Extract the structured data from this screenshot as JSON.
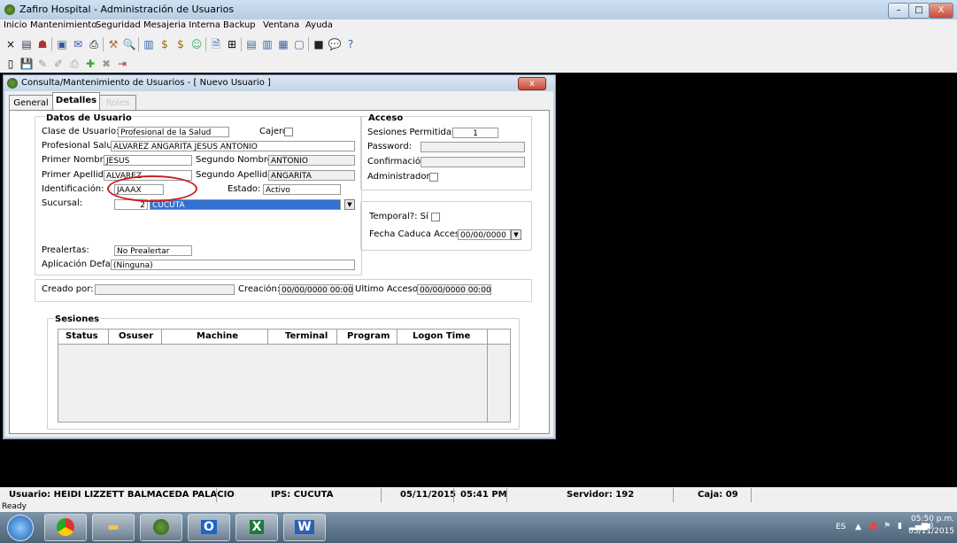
{
  "window": {
    "title": "Zafiro Hospital - Administración de Usuarios",
    "minimize": "–",
    "maximize": "□",
    "close": "X"
  },
  "menu": [
    "Inicio",
    "Mantenimiento",
    "Seguridad",
    "Mesajeria Interna",
    "Backup",
    "Ventana",
    "Ayuda"
  ],
  "dialog": {
    "title": "Consulta/Mantenimiento de Usuarios - [ Nuevo Usuario ]",
    "close": "x",
    "tabs": [
      "General",
      "Detalles",
      "Roles"
    ]
  },
  "datos": {
    "group_title": "Datos de Usuario",
    "clase_label": "Clase de Usuario:",
    "clase_value": "Profesional de la Salud",
    "cajero_label": "Cajero",
    "profesional_label": "Profesional Salud:",
    "profesional_value": "ALVAREZ ANGARITA JESUS ANTONIO",
    "primer_nombre_label": "Primer Nombre:",
    "primer_nombre_value": "JESUS",
    "segundo_nombre_label": "Segundo Nombre:",
    "segundo_nombre_value": "ANTONIO",
    "primer_apellido_label": "Primer Apellido:",
    "primer_apellido_value": "ALVAREZ",
    "segundo_apellido_label": "Segundo Apellido:",
    "segundo_apellido_value": "ANGARITA",
    "identificacion_label": "Identificación:",
    "identificacion_value": "JAAAX",
    "estado_label": "Estado:",
    "estado_value": "Activo",
    "sucursal_label": "Sucursal:",
    "sucursal_code": "2",
    "sucursal_value": "CUCUTA",
    "prealertas_label": "Prealertas:",
    "prealertas_value": "No Prealertar",
    "aplicacion_label": "Aplicación Default:",
    "aplicacion_value": "(Ninguna)"
  },
  "acceso": {
    "group_title": "Acceso",
    "sesiones_label": "Sesiones Permitidas:",
    "sesiones_value": "1",
    "password_label": "Password:",
    "confirmacion_label": "Confirmación:",
    "administrador_label": "Administrador?",
    "temporal_label": "Temporal?: Sí",
    "fecha_caduca_label": "Fecha Caduca Acceso:",
    "fecha_caduca_value": "00/00/0000"
  },
  "audit": {
    "creado_label": "Creado por:",
    "creacion_label": "Creación:",
    "creacion_value": "00/00/0000 00:00",
    "ultimo_label": "Ultimo Acceso:",
    "ultimo_value": "00/00/0000 00:00"
  },
  "sesiones": {
    "group_title": "Sesiones",
    "columns": [
      "Status",
      "Osuser",
      "Machine",
      "Terminal",
      "Program",
      "Logon Time"
    ]
  },
  "statusbar": {
    "usuario": "Usuario: HEIDI LIZZETT BALMACEDA PALACIO",
    "ips": "IPS: CUCUTA",
    "fecha": "05/11/2015",
    "hora": "05:41 PM",
    "servidor": "Servidor: 192",
    "caja": "Caja: 09",
    "ready": "Ready"
  },
  "taskbar": {
    "lang": "ES",
    "time": "05:50 p.m.",
    "date": "05/11/2015"
  },
  "colors": {
    "accent_highlight": "#3370d4",
    "annotation_circle": "#cc1f1f"
  }
}
